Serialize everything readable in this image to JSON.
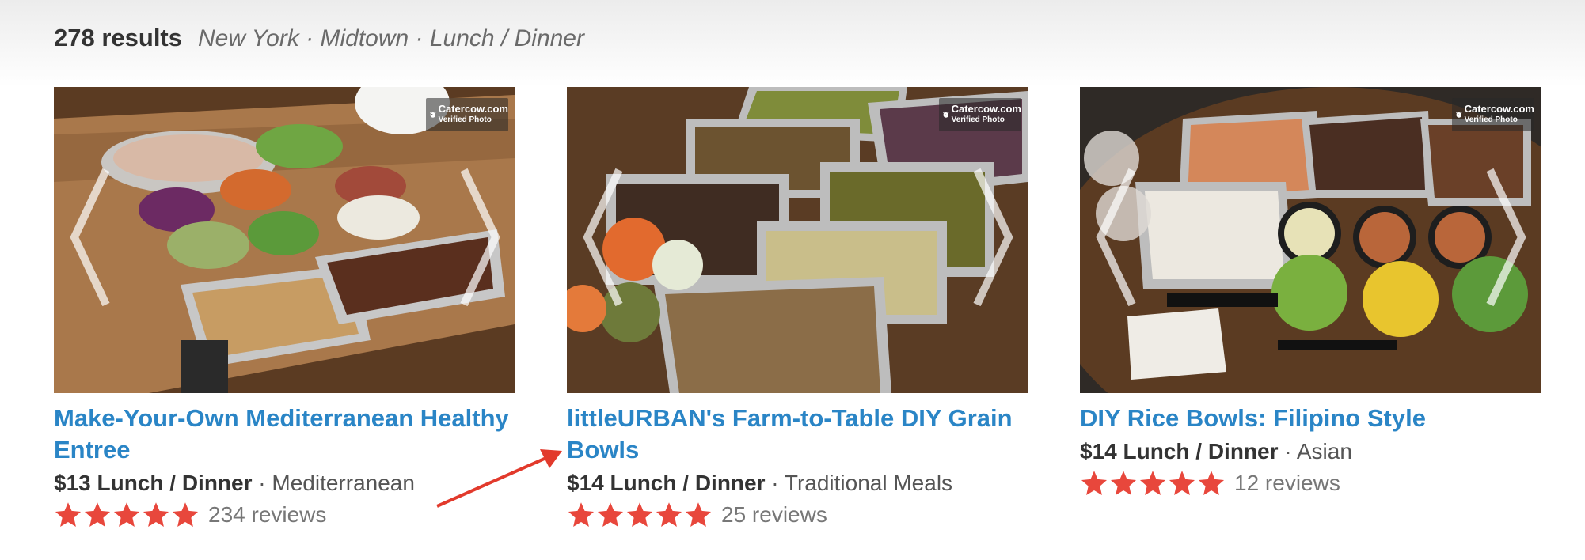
{
  "header": {
    "results_count": "278 results",
    "filters": "New York · Midtown · Lunch / Dinner"
  },
  "badge": {
    "brand": "Catercow.com",
    "sub": "Verified Photo"
  },
  "icons": {
    "prev": "chevron-left-icon",
    "next": "chevron-right-icon",
    "star": "star-icon",
    "badge": "catercow-logo-icon"
  },
  "colors": {
    "title_link": "#2a85c6",
    "star": "#e8473c",
    "annotation_arrow": "#e23a2c"
  },
  "cards": [
    {
      "title": "Make-Your-Own Mediterranean Healthy Entree",
      "price": "$13 Lunch / Dinner",
      "separator": " · ",
      "cuisine": "Mediterranean",
      "rating": 5,
      "reviews": "234 reviews"
    },
    {
      "title": "littleURBAN's Farm-to-Table DIY Grain Bowls",
      "price": "$14 Lunch / Dinner",
      "separator": " · ",
      "cuisine": "Traditional Meals",
      "rating": 5,
      "reviews": "25 reviews"
    },
    {
      "title": "DIY Rice Bowls: Filipino Style",
      "price": "$14 Lunch / Dinner",
      "separator": " · ",
      "cuisine": "Asian",
      "rating": 5,
      "reviews": "12 reviews"
    }
  ]
}
